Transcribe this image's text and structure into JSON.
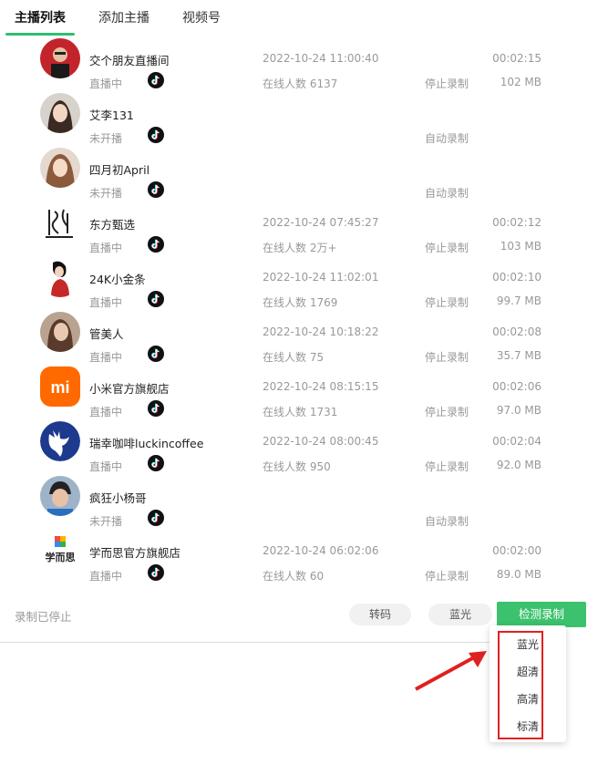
{
  "tabs": [
    {
      "label": "主播列表",
      "active": true
    },
    {
      "label": "添加主播",
      "active": false
    },
    {
      "label": "视频号",
      "active": false
    }
  ],
  "streamers": [
    {
      "name": "交个朋友直播间",
      "status": "直播中",
      "time": "2022-10-24 11:00:40",
      "viewers": "在线人数 6137",
      "action": "停止录制",
      "duration": "00:02:15",
      "size": "102 MB"
    },
    {
      "name": "艾李131",
      "status": "未开播",
      "time": "",
      "viewers": "",
      "action": "自动录制",
      "duration": "",
      "size": ""
    },
    {
      "name": "四月初April",
      "status": "未开播",
      "time": "",
      "viewers": "",
      "action": "自动录制",
      "duration": "",
      "size": ""
    },
    {
      "name": "东方甄选",
      "status": "直播中",
      "time": "2022-10-24 07:45:27",
      "viewers": "在线人数 2万+",
      "action": "停止录制",
      "duration": "00:02:12",
      "size": "103 MB"
    },
    {
      "name": "24K小金条",
      "status": "直播中",
      "time": "2022-10-24 11:02:01",
      "viewers": "在线人数 1769",
      "action": "停止录制",
      "duration": "00:02:10",
      "size": "99.7 MB"
    },
    {
      "name": "管美人",
      "status": "直播中",
      "time": "2022-10-24 10:18:22",
      "viewers": "在线人数 75",
      "action": "停止录制",
      "duration": "00:02:08",
      "size": "35.7 MB"
    },
    {
      "name": "小米官方旗舰店",
      "status": "直播中",
      "time": "2022-10-24 08:15:15",
      "viewers": "在线人数 1731",
      "action": "停止录制",
      "duration": "00:02:06",
      "size": "97.0 MB"
    },
    {
      "name": "瑞幸咖啡luckincoffee",
      "status": "直播中",
      "time": "2022-10-24 08:00:45",
      "viewers": "在线人数 950",
      "action": "停止录制",
      "duration": "00:02:04",
      "size": "92.0 MB"
    },
    {
      "name": "疯狂小杨哥",
      "status": "未开播",
      "time": "",
      "viewers": "",
      "action": "自动录制",
      "duration": "",
      "size": ""
    },
    {
      "name": "学而思官方旗舰店",
      "status": "直播中",
      "time": "2022-10-24 06:02:06",
      "viewers": "在线人数 60",
      "action": "停止录制",
      "duration": "00:02:00",
      "size": "89.0 MB"
    }
  ],
  "footer": {
    "status": "录制已停止",
    "transcode_label": "转码",
    "quality_label": "蓝光",
    "detect_label": "检测录制"
  },
  "quality_menu": {
    "options": [
      "蓝光",
      "超清",
      "高清",
      "标清"
    ]
  },
  "logos": {
    "xiaomi_text": "mi",
    "xueersi_text": "学而思"
  },
  "colors": {
    "accent": "#3cc26e",
    "highlight": "#e02020"
  }
}
